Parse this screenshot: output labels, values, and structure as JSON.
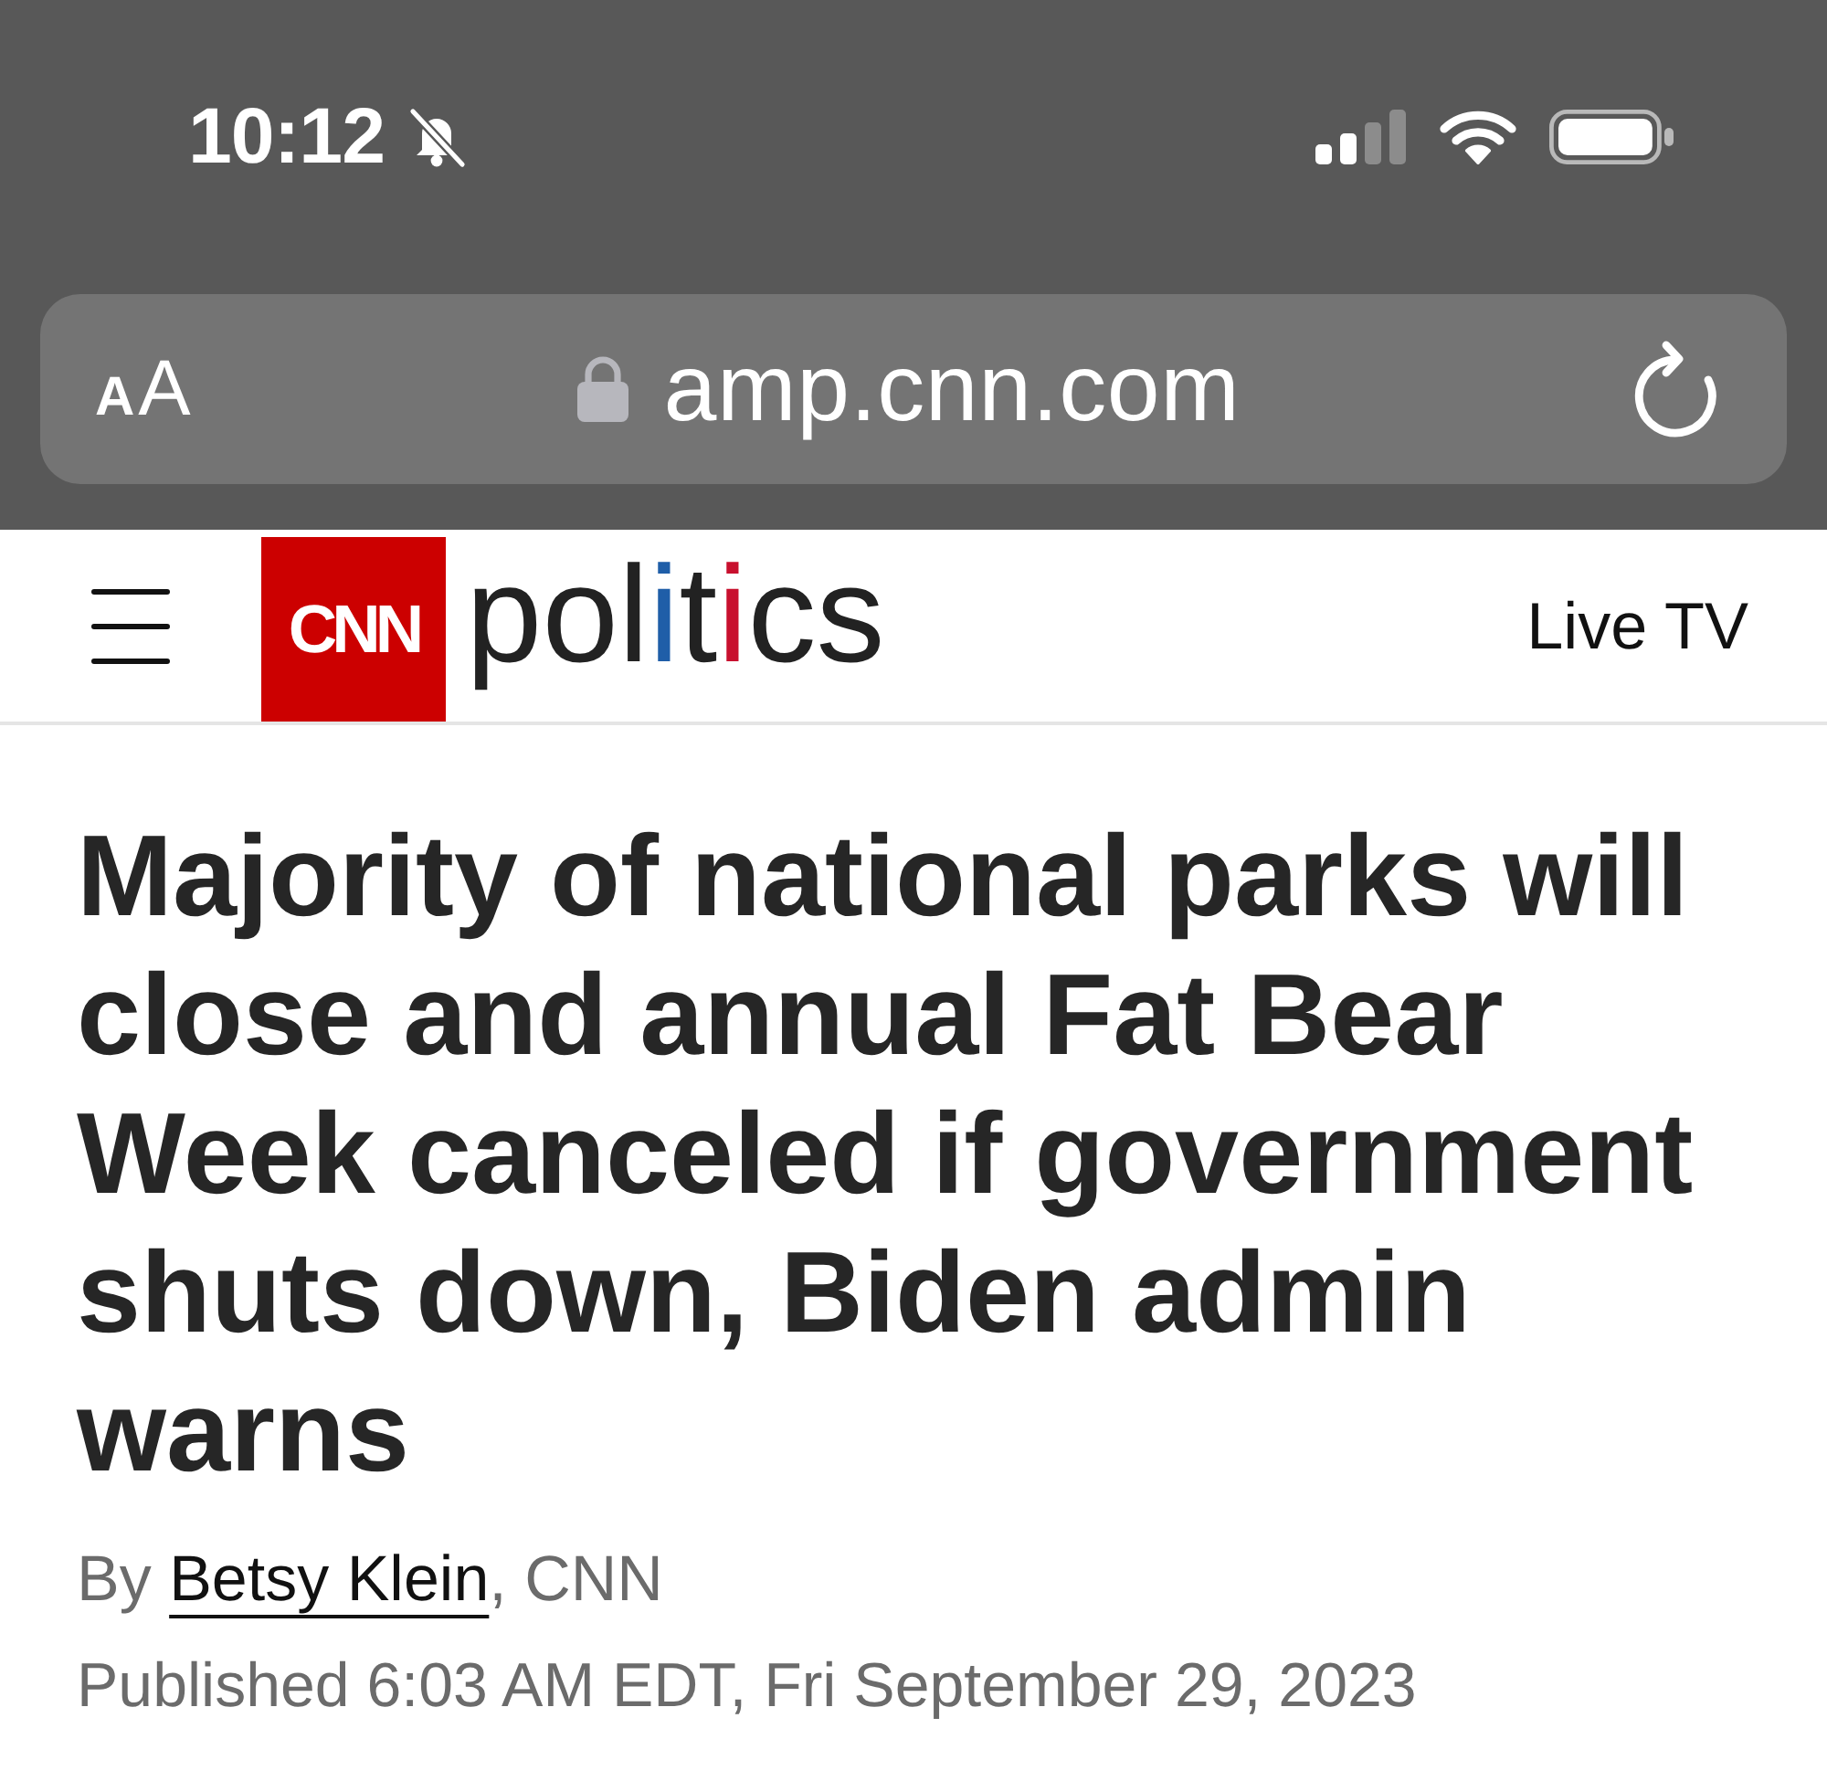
{
  "status_bar": {
    "time": "10:12"
  },
  "address_bar": {
    "text_size_button": {
      "small_letter": "A",
      "large_letter": "A"
    },
    "secure": true,
    "url": "amp.cnn.com"
  },
  "site_header": {
    "brand_logo": "CNN",
    "section_logo": "politics",
    "live_tv_link": "Live TV"
  },
  "article": {
    "headline": "Majority of national parks will close and annual Fat Bear Week canceled if government shuts down, Biden admin warns",
    "byline": {
      "prefix": "By ",
      "author": "Betsy Klein",
      "suffix": ", CNN"
    },
    "published": "Published 6:03 AM EDT, Fri September 29, 2023"
  }
}
